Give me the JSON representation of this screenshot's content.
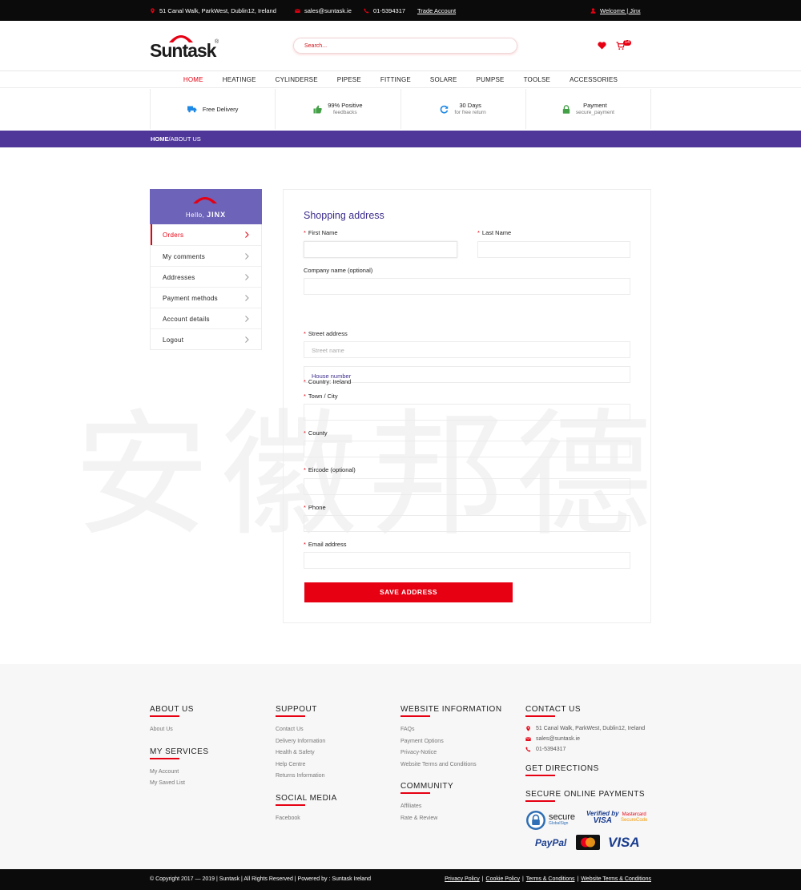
{
  "topbar": {
    "address": "51 Canal Walk,  ParkWest,  Dublin12,  Ireland",
    "email": "sales@suntask.ie",
    "phone": "01-5394317",
    "trade_account": "Trade Account",
    "welcome": "Welcome  |  Jinx"
  },
  "header": {
    "logo": "Suntask",
    "search_placeholder": "Search...",
    "cart_count": "14"
  },
  "nav": [
    "HOME",
    "HEATINGE",
    "CYLINDERSE",
    "PIPESE",
    "FITTINGE",
    "SOLARE",
    "PUMPSE",
    "TOOLSE",
    "ACCESSORIES"
  ],
  "features": [
    {
      "title": "Free Delivery",
      "sub": "",
      "icon": "truck-icon",
      "color": "#1e88e5"
    },
    {
      "title": "99% Positive",
      "sub": "feedbacks",
      "icon": "thumbs-up-icon",
      "color": "#43a047"
    },
    {
      "title": "30 Days",
      "sub": "for free return",
      "icon": "refresh-icon",
      "color": "#1e88e5"
    },
    {
      "title": "Payment",
      "sub": "secure_payment",
      "icon": "lock-icon",
      "color": "#43a047"
    }
  ],
  "breadcrumb": {
    "home": "HOME",
    "sep": "/",
    "current": "ABOUT US"
  },
  "watermark": "安徽邦德",
  "sidebar": {
    "hello": "Hello,",
    "user": "JINX",
    "items": [
      "Orders",
      "My comments",
      "Addresses",
      "Payment methods",
      "Account details",
      "Logout"
    ]
  },
  "form": {
    "title": "Shopping address",
    "first_name": "First Name",
    "last_name": "Last Name",
    "company": "Company name (optional)",
    "street": "Street address",
    "street_placeholder": "Street name",
    "house_placeholder": "House number",
    "country": "Country: Ireland",
    "town": "Town / City",
    "county": "County",
    "eircode": "Eircode (optional)",
    "phone": "Phone",
    "email": "Email address",
    "save": "SAVE ADDRESS"
  },
  "footer": {
    "about": {
      "title": "ABOUT US",
      "links": [
        "About Us"
      ]
    },
    "services": {
      "title": "MY SERVICES",
      "links": [
        "My Account",
        "My Saved List"
      ]
    },
    "support": {
      "title": "SUPPOUT",
      "links": [
        "Contact Us",
        "Delivery Information",
        "Health & Safety",
        "Help Centre",
        "Returns Information"
      ]
    },
    "social": {
      "title": "SOCIAL MEDIA",
      "links": [
        "Facebook"
      ]
    },
    "website": {
      "title": "WEBSITE INFORMATION",
      "links": [
        "FAQs",
        "Payment Options",
        "Privacy-Notice",
        "Website Terms and Conditions"
      ]
    },
    "community": {
      "title": "COMMUNITY",
      "links": [
        "Affiliates",
        "Rate & Review"
      ]
    },
    "contact": {
      "title": "CONTACT US",
      "address": "51 Canal Walk,  ParkWest,  Dublin12,  Ireland",
      "email": "sales@suntask.ie",
      "phone": "01-5394317"
    },
    "directions": "GET DIRECTIONS",
    "payments_title": "SECURE ONLINE PAYMENTS",
    "secure": "secure",
    "globalsign": "GlobalSign",
    "verified": "Verified by",
    "visa": "VISA",
    "mastercard": "Mastercard",
    "securecode": "SecureCode",
    "paypal": "PayPal"
  },
  "bottom": {
    "copyright": "© Copyright 2017 — 2019 | Suntask | All Rights Reserved | Powered by : Suntask Ireland",
    "links": [
      "Privacy Policy",
      "Cookie Policy",
      "Terms & Conditions",
      "Website Terms & Conditions"
    ]
  }
}
